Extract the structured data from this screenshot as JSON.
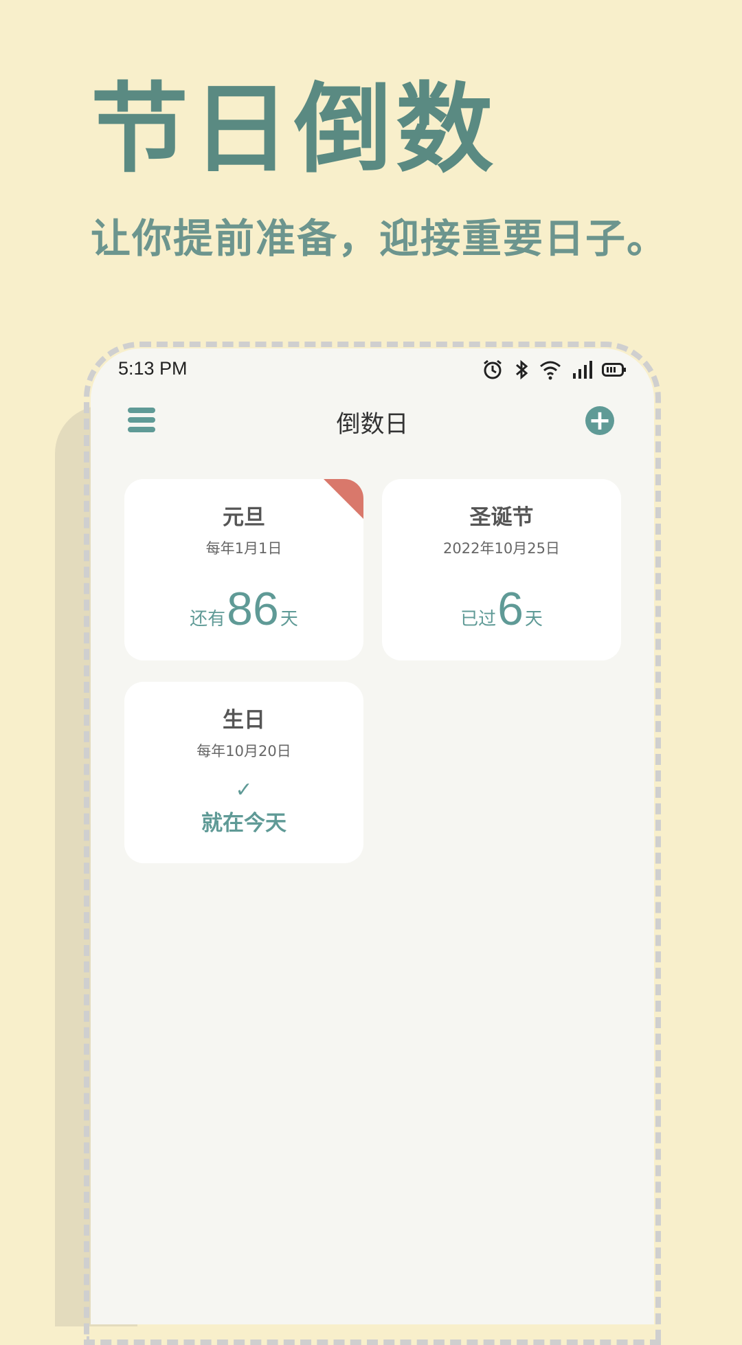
{
  "hero": {
    "title": "节日倒数",
    "subtitle": "让你提前准备，迎接重要日子。"
  },
  "status_bar": {
    "time": "5:13 PM",
    "icons": [
      "alarm-icon",
      "bluetooth-icon",
      "wifi-icon",
      "signal-icon",
      "battery-icon"
    ]
  },
  "app_bar": {
    "title": "倒数日",
    "menu_icon": "menu-icon",
    "add_icon": "add-icon"
  },
  "events": [
    {
      "title": "元旦",
      "date": "每年1月1日",
      "prefix": "还有",
      "days": "86",
      "suffix": "天",
      "pinned": true
    },
    {
      "title": "圣诞节",
      "date": "2022年10月25日",
      "prefix": "已过",
      "days": "6",
      "suffix": "天",
      "pinned": false
    },
    {
      "title": "生日",
      "date": "每年10月20日",
      "status": "就在今天",
      "status_icon": "check-icon"
    }
  ],
  "colors": {
    "background": "#f8efcb",
    "accent": "#5f9a96",
    "pin": "#d9786b",
    "screen": "#f6f6f2"
  }
}
